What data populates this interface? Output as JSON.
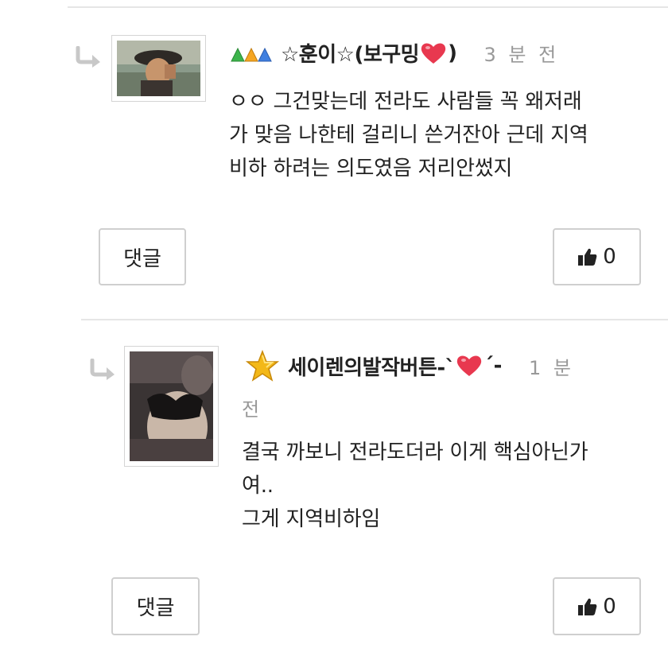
{
  "comments": [
    {
      "level_icon": "triple-triangle-level-icon",
      "nickname": "☆훈이☆(보구밍",
      "nickname_suffix": ")",
      "time": "3 분 전",
      "body": "ㅇㅇ 그건맞는데 전라도 사람들 꼭 왜저래\n가 맞음 나한테 걸리니 쓴거잔아 근데 지역\n비하 하려는 의도였음 저리안썼지",
      "reply_label": "댓글",
      "like_count": "0"
    },
    {
      "level_icon": "gold-star-level-icon",
      "nickname": "세이렌의발작버튼-`",
      "nickname_suffix": "´-",
      "time_part1": "1 분",
      "time_part2": "전",
      "body": "결국 까보니 전라도더라 이게 핵심아닌가\n여..\n그게 지역비하임",
      "reply_label": "댓글",
      "like_count": "0"
    }
  ],
  "colors": {
    "heart": "#e8384f",
    "star": "#f3b817",
    "arrow": "#c8c8c8",
    "time": "#999999"
  }
}
